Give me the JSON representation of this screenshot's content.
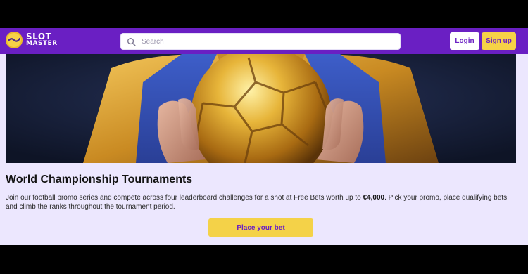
{
  "brand": {
    "name_line1": "SLOT",
    "name_line2": "MASTER",
    "colors": {
      "header_bg": "#6A1FC3",
      "accent_yellow": "#F6D247",
      "page_bg": "#ECE7FE",
      "button_text": "#6A1FC3"
    }
  },
  "header": {
    "search_placeholder": "Search",
    "search_icon": "search-icon",
    "login_label": "Login",
    "signup_label": "Sign up"
  },
  "banner": {
    "description_icon": "golden-football-held-in-hands"
  },
  "main": {
    "title": "World Championship Tournaments",
    "description_before": "Join our football promo series and compete across four leaderboard challenges for a shot at Free Bets worth up to ",
    "description_amount": "€4,000",
    "description_after": ". Pick your promo, place qualifying bets, and climb the ranks throughout the tournament period.",
    "cta_label": "Place your bet"
  }
}
